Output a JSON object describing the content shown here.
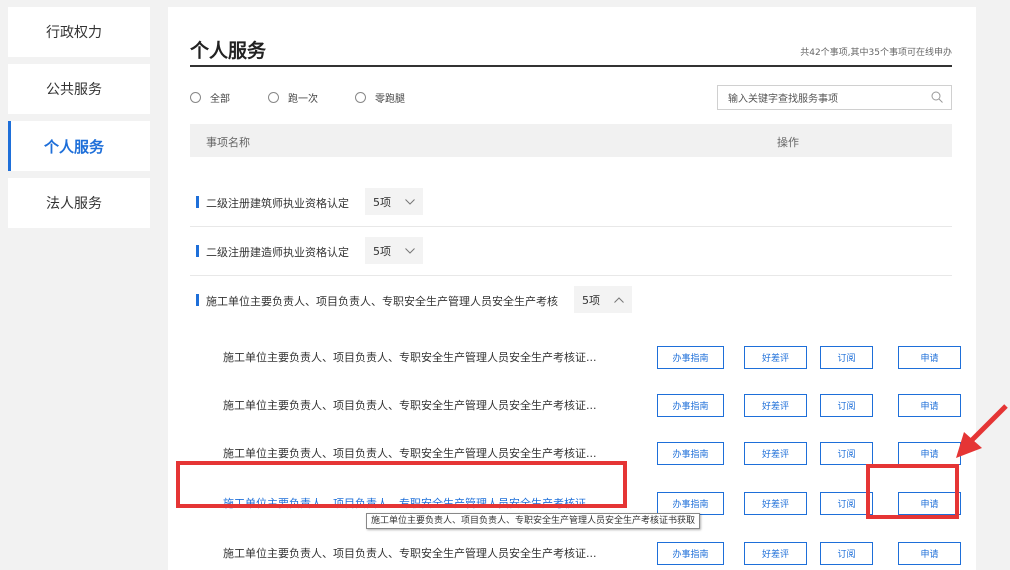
{
  "sidebar": {
    "items": [
      {
        "label": "行政权力"
      },
      {
        "label": "公共服务"
      },
      {
        "label": "个人服务"
      },
      {
        "label": "法人服务"
      }
    ]
  },
  "main": {
    "title": "个人服务",
    "summary": "共42个事项,其中35个事项可在线申办",
    "filters": [
      "全部",
      "跑一次",
      "零跑腿"
    ],
    "search_placeholder": "输入关键字查找服务事项",
    "table_headers": [
      "事项名称",
      "操作"
    ],
    "groups": [
      {
        "name": "二级注册建筑师执业资格认定",
        "count": "5项"
      },
      {
        "name": "二级注册建造师执业资格认定",
        "count": "5项"
      },
      {
        "name": "施工单位主要负责人、项目负责人、专职安全生产管理人员安全生产考核",
        "count": "5项"
      }
    ],
    "sub_items": [
      {
        "name": "施工单位主要负责人、项目负责人、专职安全生产管理人员安全生产考核证..."
      },
      {
        "name": "施工单位主要负责人、项目负责人、专职安全生产管理人员安全生产考核证..."
      },
      {
        "name": "施工单位主要负责人、项目负责人、专职安全生产管理人员安全生产考核证..."
      },
      {
        "name": "施工单位主要负责人、项目负责人、专职安全生产管理人员安全生产考核证..."
      },
      {
        "name": "施工单位主要负责人、项目负责人、专职安全生产管理人员安全生产考核证..."
      }
    ],
    "buttons": {
      "guide": "办事指南",
      "rate": "好差评",
      "subscribe": "订阅",
      "apply": "申请"
    },
    "tooltip": "施工单位主要负责人、项目负责人、专职安全生产管理人员安全生产考核证书获取"
  },
  "colors": {
    "accent": "#1e6fd9",
    "highlight": "#e53535"
  }
}
